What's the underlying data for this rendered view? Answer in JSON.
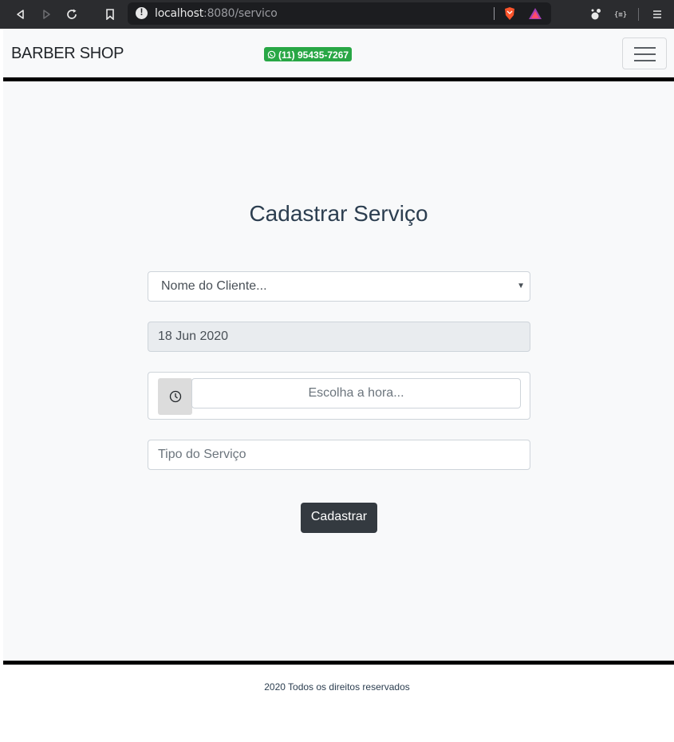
{
  "browser": {
    "url_host": "localhost",
    "url_path": ":8080/servico"
  },
  "navbar": {
    "brand": "BARBER SHOP",
    "phone": "(11) 95435-7267"
  },
  "form": {
    "title": "Cadastrar Serviço",
    "client_select": "Nome do Cliente...",
    "date_value": "18 Jun 2020",
    "time_placeholder": "Escolha a hora...",
    "service_placeholder": "Tipo do Serviço",
    "submit_label": "Cadastrar"
  },
  "footer": {
    "text": "2020 Todos os direitos reservados"
  },
  "colors": {
    "accent_green": "#28a745",
    "button_dark": "#343a40",
    "title_color": "#2c3e50"
  }
}
